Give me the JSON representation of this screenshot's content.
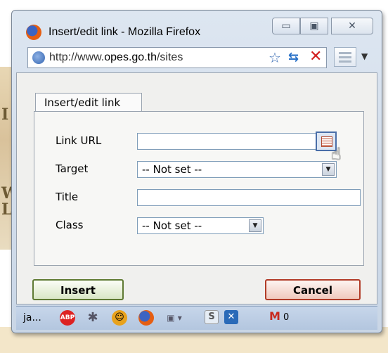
{
  "window": {
    "title": "Insert/edit link - Mozilla Firefox"
  },
  "addressbar": {
    "url_prefix": "http://www.",
    "url_domain": "opes.go.th",
    "url_suffix": "/sites"
  },
  "tab": {
    "label": "Insert/edit link"
  },
  "form": {
    "link_url_label": "Link URL",
    "link_url_value": "",
    "target_label": "Target",
    "target_value": "-- Not set --",
    "title_label": "Title",
    "title_value": "",
    "class_label": "Class",
    "class_value": "-- Not set --"
  },
  "buttons": {
    "insert": "Insert",
    "cancel": "Cancel"
  },
  "statusbar": {
    "text": "ja...",
    "adblock": "ABP",
    "mail_count": "0"
  },
  "background": {
    "letters": [
      "I",
      "W",
      "L"
    ]
  }
}
